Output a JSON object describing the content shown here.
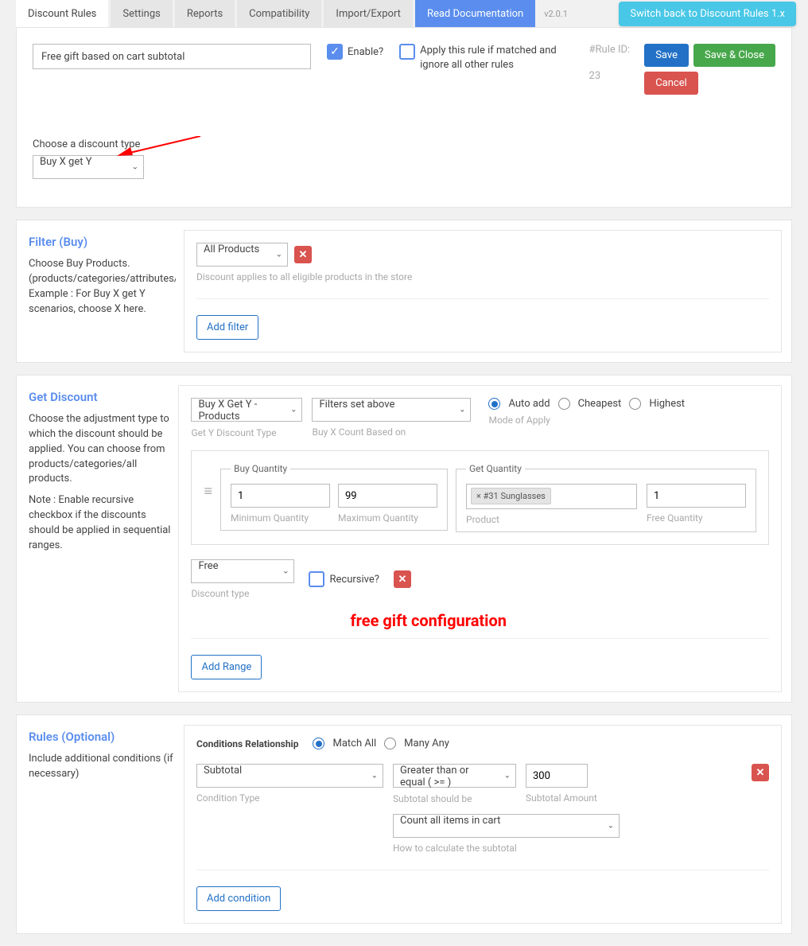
{
  "tabs": {
    "discount_rules": "Discount Rules",
    "settings": "Settings",
    "reports": "Reports",
    "compatibility": "Compatibility",
    "import_export": "Import/Export",
    "read_docs": "Read Documentation"
  },
  "version": "v2.0.1",
  "switch_back": "Switch back to Discount Rules 1.x",
  "rule_title": "Free gift based on cart subtotal",
  "enable_label": "Enable?",
  "apply_rule_label": "Apply this rule if matched and ignore all other rules",
  "rule_id_label": "#Rule ID:",
  "rule_id_value": "23",
  "buttons": {
    "save": "Save",
    "save_close": "Save & Close",
    "cancel": "Cancel",
    "add_filter": "Add filter",
    "add_range": "Add Range",
    "add_condition": "Add condition"
  },
  "discount_type_label": "Choose a discount type",
  "discount_type_value": "Buy X get Y",
  "filter": {
    "heading": "Filter (Buy)",
    "desc": "Choose Buy Products. (products/categories/attributes/tags/sku) Example : For Buy X get Y scenarios, choose X here.",
    "product_select": "All Products",
    "hint": "Discount applies to all eligible products in the store"
  },
  "discount": {
    "heading": "Get Discount",
    "desc1": "Choose the adjustment type to which the discount should be applied. You can choose from products/categories/all products.",
    "desc2": "Note : Enable recursive checkbox if the discounts should be applied in sequential ranges.",
    "gety_type": "Buy X Get Y - Products",
    "gety_type_label": "Get Y Discount Type",
    "buyx_count": "Filters set above",
    "buyx_count_label": "Buy X Count Based on",
    "mode_options": {
      "auto": "Auto add",
      "cheap": "Cheapest",
      "high": "Highest"
    },
    "mode_label": "Mode of Apply",
    "buy_qty_legend": "Buy Quantity",
    "min_qty": "1",
    "min_qty_label": "Minimum Quantity",
    "max_qty": "99",
    "max_qty_label": "Maximum Quantity",
    "get_qty_legend": "Get Quantity",
    "product_tag": "× #31 Sunglasses",
    "product_label": "Product",
    "free_qty": "1",
    "free_qty_label": "Free Quantity",
    "disc_type": "Free",
    "disc_type_label": "Discount type",
    "recursive_label": "Recursive?",
    "annotation": "free gift configuration"
  },
  "rules": {
    "heading": "Rules (Optional)",
    "desc": "Include additional conditions (if necessary)",
    "rel_label": "Conditions Relationship",
    "match_all": "Match All",
    "many_any": "Many Any",
    "cond_type": "Subtotal",
    "cond_type_label": "Condition Type",
    "operator": "Greater than or equal ( >= )",
    "operator_label": "Subtotal should be",
    "amount": "300",
    "amount_label": "Subtotal Amount",
    "calc": "Count all items in cart",
    "calc_label": "How to calculate the subtotal"
  }
}
